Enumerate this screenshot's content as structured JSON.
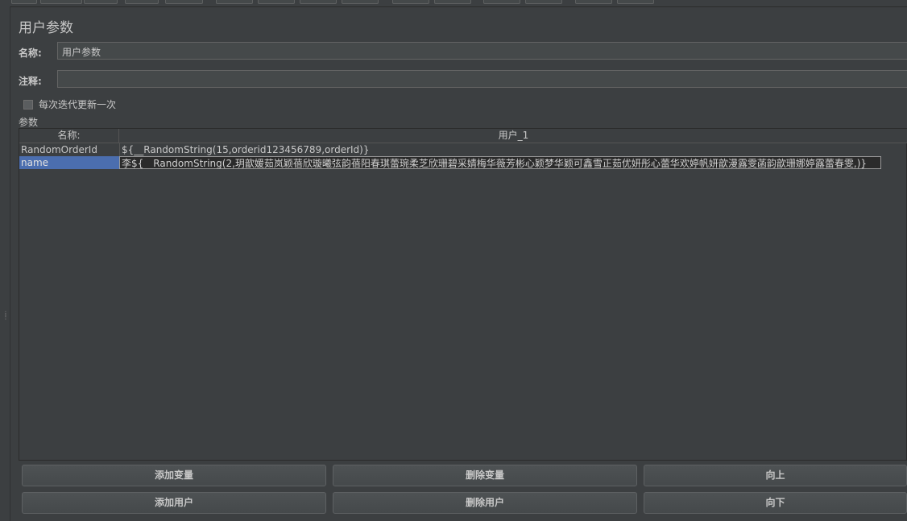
{
  "panel": {
    "title": "用户参数",
    "name_label": "名称:",
    "name_value": "用户参数",
    "comment_label": "注释:",
    "comment_value": "",
    "checkbox_label": "每次迭代更新一次",
    "checkbox_checked": false,
    "params_label": "参数"
  },
  "table": {
    "headers": [
      "名称:",
      "用户_1"
    ],
    "rows": [
      {
        "name": "RandomOrderId",
        "value": "${__RandomString(15,orderid123456789,orderId)}"
      },
      {
        "name": "name",
        "value": "李${__RandomString(2,玥歆媛茹岚颖蓓欣璇曦弦韵蓓阳春琪蕾琬柔芝欣珊碧采婧梅华薇芳彬心颖梦华颖可鑫雪正茹优妍彤心蕾华欢婷帆妍歆漫露雯菡韵歆珊娜婷露蕾春雯,)}"
      }
    ],
    "selected_row": 1
  },
  "buttons": {
    "add_var": "添加变量",
    "del_var": "删除变量",
    "up": "向上",
    "add_user": "添加用户",
    "del_user": "删除用户",
    "down": "向下"
  },
  "colors": {
    "background": "#3c3f41",
    "selection": "#4b6eaf",
    "field_bg": "#45494a"
  }
}
